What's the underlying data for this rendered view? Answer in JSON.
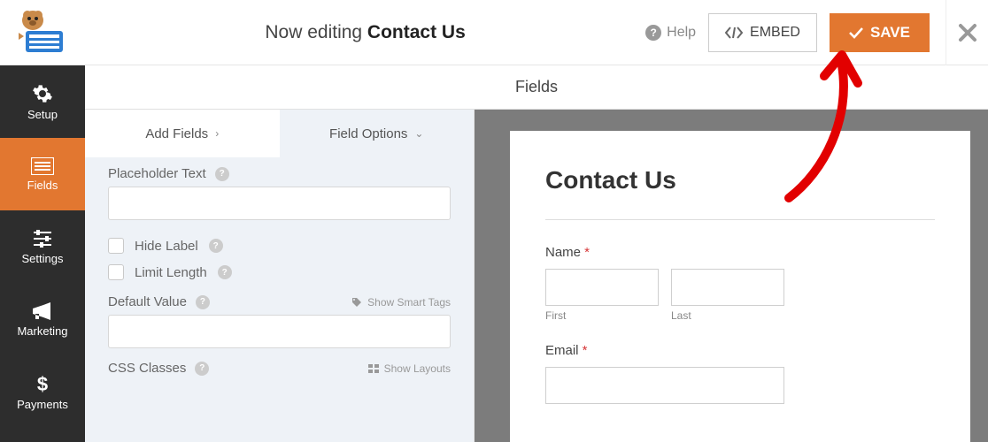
{
  "header": {
    "editing_prefix": "Now editing ",
    "form_name": "Contact Us",
    "help_label": "Help",
    "embed_label": "EMBED",
    "save_label": "SAVE"
  },
  "sidebar": {
    "items": [
      {
        "key": "setup",
        "label": "Setup",
        "icon": "gear"
      },
      {
        "key": "fields",
        "label": "Fields",
        "icon": "list",
        "active": true
      },
      {
        "key": "settings",
        "label": "Settings",
        "icon": "sliders"
      },
      {
        "key": "marketing",
        "label": "Marketing",
        "icon": "megaphone"
      },
      {
        "key": "payments",
        "label": "Payments",
        "icon": "dollar"
      }
    ]
  },
  "section_title": "Fields",
  "tabs": {
    "add_fields": "Add Fields",
    "field_options": "Field Options"
  },
  "options": {
    "placeholder_text": {
      "label": "Placeholder Text",
      "value": ""
    },
    "hide_label": {
      "label": "Hide Label",
      "checked": false
    },
    "limit_length": {
      "label": "Limit Length",
      "checked": false
    },
    "default_value": {
      "label": "Default Value",
      "value": "",
      "smart_tags": "Show Smart Tags"
    },
    "css_classes": {
      "label": "CSS Classes",
      "show_layouts": "Show Layouts"
    }
  },
  "preview": {
    "form_title": "Contact Us",
    "name": {
      "label": "Name",
      "first": "First",
      "last": "Last",
      "required": true
    },
    "email": {
      "label": "Email",
      "required": true
    }
  }
}
